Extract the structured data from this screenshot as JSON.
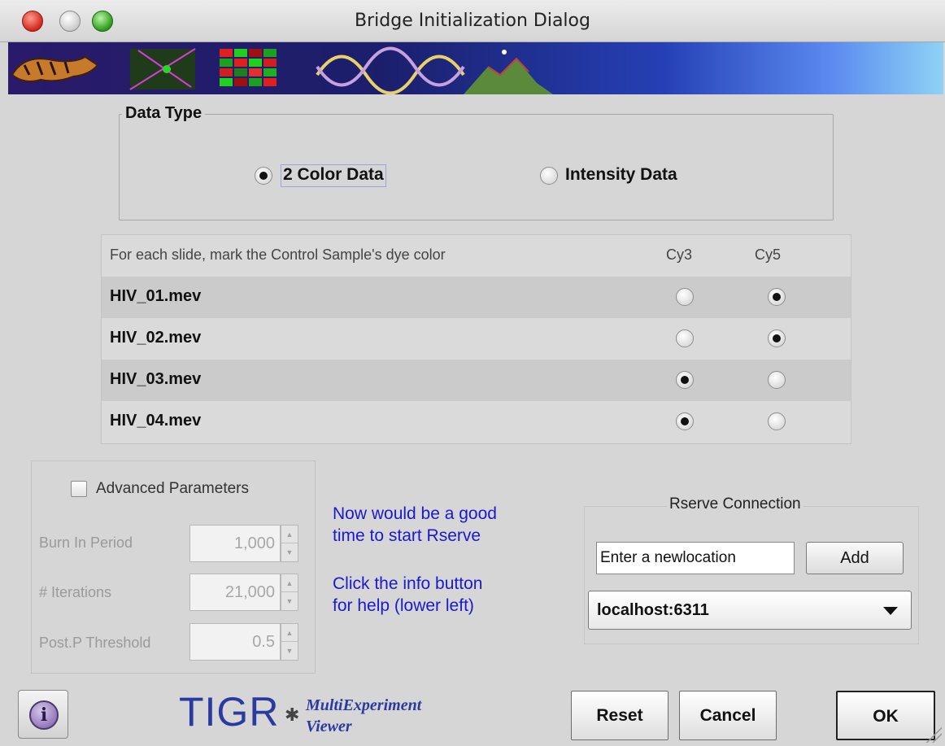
{
  "window": {
    "title": "Bridge Initialization Dialog"
  },
  "data_type": {
    "group_label": "Data Type",
    "options": [
      {
        "label": "2 Color Data",
        "selected": true
      },
      {
        "label": "Intensity Data",
        "selected": false
      }
    ]
  },
  "slides": {
    "header": "For each slide, mark the Control Sample's dye color",
    "col1": "Cy3",
    "col2": "Cy5",
    "rows": [
      {
        "name": "HIV_01.mev",
        "dye": "Cy5"
      },
      {
        "name": "HIV_02.mev",
        "dye": "Cy5"
      },
      {
        "name": "HIV_03.mev",
        "dye": "Cy3"
      },
      {
        "name": "HIV_04.mev",
        "dye": "Cy3"
      }
    ]
  },
  "advanced": {
    "checkbox_label": "Advanced Parameters",
    "checked": false,
    "burn_in_label": "Burn In Period",
    "burn_in_value": "1,000",
    "iterations_label": "# Iterations",
    "iterations_value": "21,000",
    "threshold_label": "Post.P Threshold",
    "threshold_value": "0.5"
  },
  "notes": {
    "line1": "Now would be a good",
    "line2": "time to start Rserve",
    "line3": "Click the info button",
    "line4": "for help (lower left)"
  },
  "rserve": {
    "label": "Rserve Connection",
    "input_value": "Enter a newlocation",
    "add_label": "Add",
    "selected": "localhost:6311"
  },
  "footer": {
    "brand": "TIGR",
    "brand_line1": "MultiExperiment",
    "brand_line2": "Viewer",
    "reset_label": "Reset",
    "cancel_label": "Cancel",
    "ok_label": "OK"
  }
}
